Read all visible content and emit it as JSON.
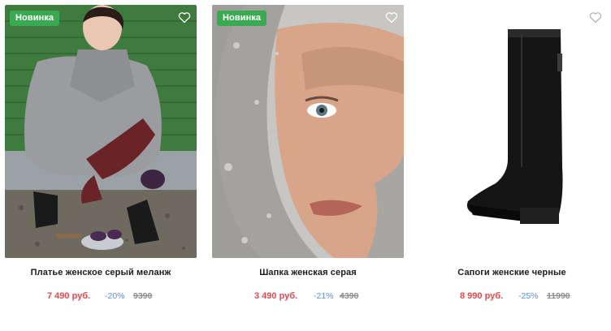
{
  "products": [
    {
      "badge": "Новинка",
      "title": "Платье женское серый меланж",
      "price": "7 490 руб.",
      "discount": "-20%",
      "old_price": "9390",
      "image": "woman-grey-sweater-photo"
    },
    {
      "badge": "Новинка",
      "title": "Шапка женская серая",
      "price": "3 490 руб.",
      "discount": "-21%",
      "old_price": "4390",
      "image": "woman-knit-hood-photo"
    },
    {
      "badge": "",
      "title": "Сапоги женские черные",
      "price": "8 990 руб.",
      "discount": "-25%",
      "old_price": "11990",
      "image": "black-boot-photo"
    }
  ],
  "icons": {
    "favorite": "heart-outline-icon"
  },
  "colors": {
    "badge": "#3aaa52",
    "price": "#e5484d",
    "discount": "#5a8fd6",
    "old_price": "#8a8a8a"
  }
}
